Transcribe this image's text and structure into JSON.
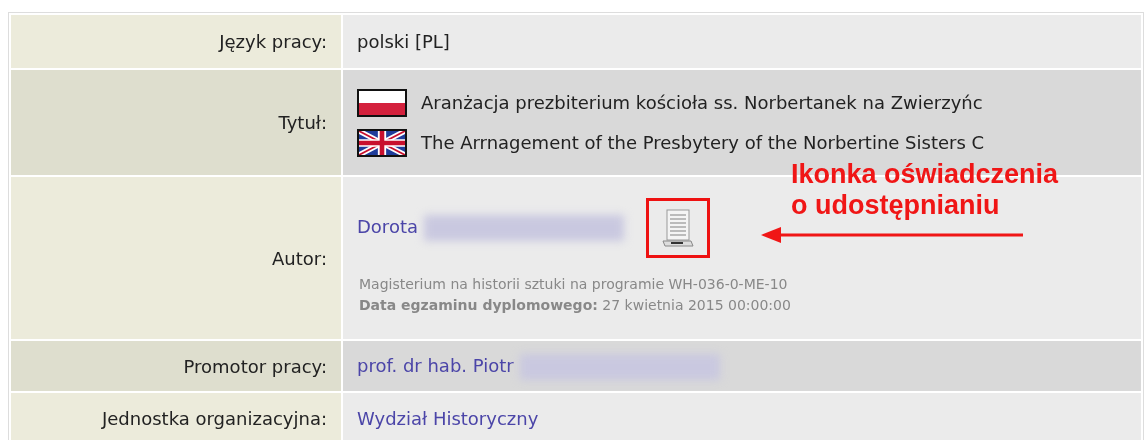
{
  "rows": [
    {
      "kind": "text",
      "label": "Język pracy:",
      "value": "polski [PL]"
    },
    {
      "kind": "titles",
      "label": "Tytuł:",
      "titles": [
        {
          "kind": "polish",
          "text": "Aranżacja prezbiterium kościoła ss. Norbertanek na Zwierzyńc"
        },
        {
          "kind": "british",
          "text": "The Arrnagement of the Presbytery of the Norbertine Sisters C"
        }
      ]
    },
    {
      "kind": "author",
      "label": "Autor:",
      "name": "Dorota",
      "redacted": true,
      "highlighted": true,
      "program": "Magisterium na historii sztuki na programie WH-036-0-ME-10",
      "exam_label": "Data egzaminu dyplomowego:",
      "exam_date": "27 kwietnia 2015 00:00:00"
    },
    {
      "kind": "link",
      "label": "Promotor pracy:",
      "value": "prof. dr hab. Piotr",
      "redacted": true
    },
    {
      "kind": "link",
      "label": "Jednostka organizacyjna:",
      "value": "Wydział Historyczny",
      "redacted": false
    }
  ],
  "annotation": {
    "lines": [
      "Ikonka oświadczenia",
      "o udostępnianiu"
    ]
  }
}
